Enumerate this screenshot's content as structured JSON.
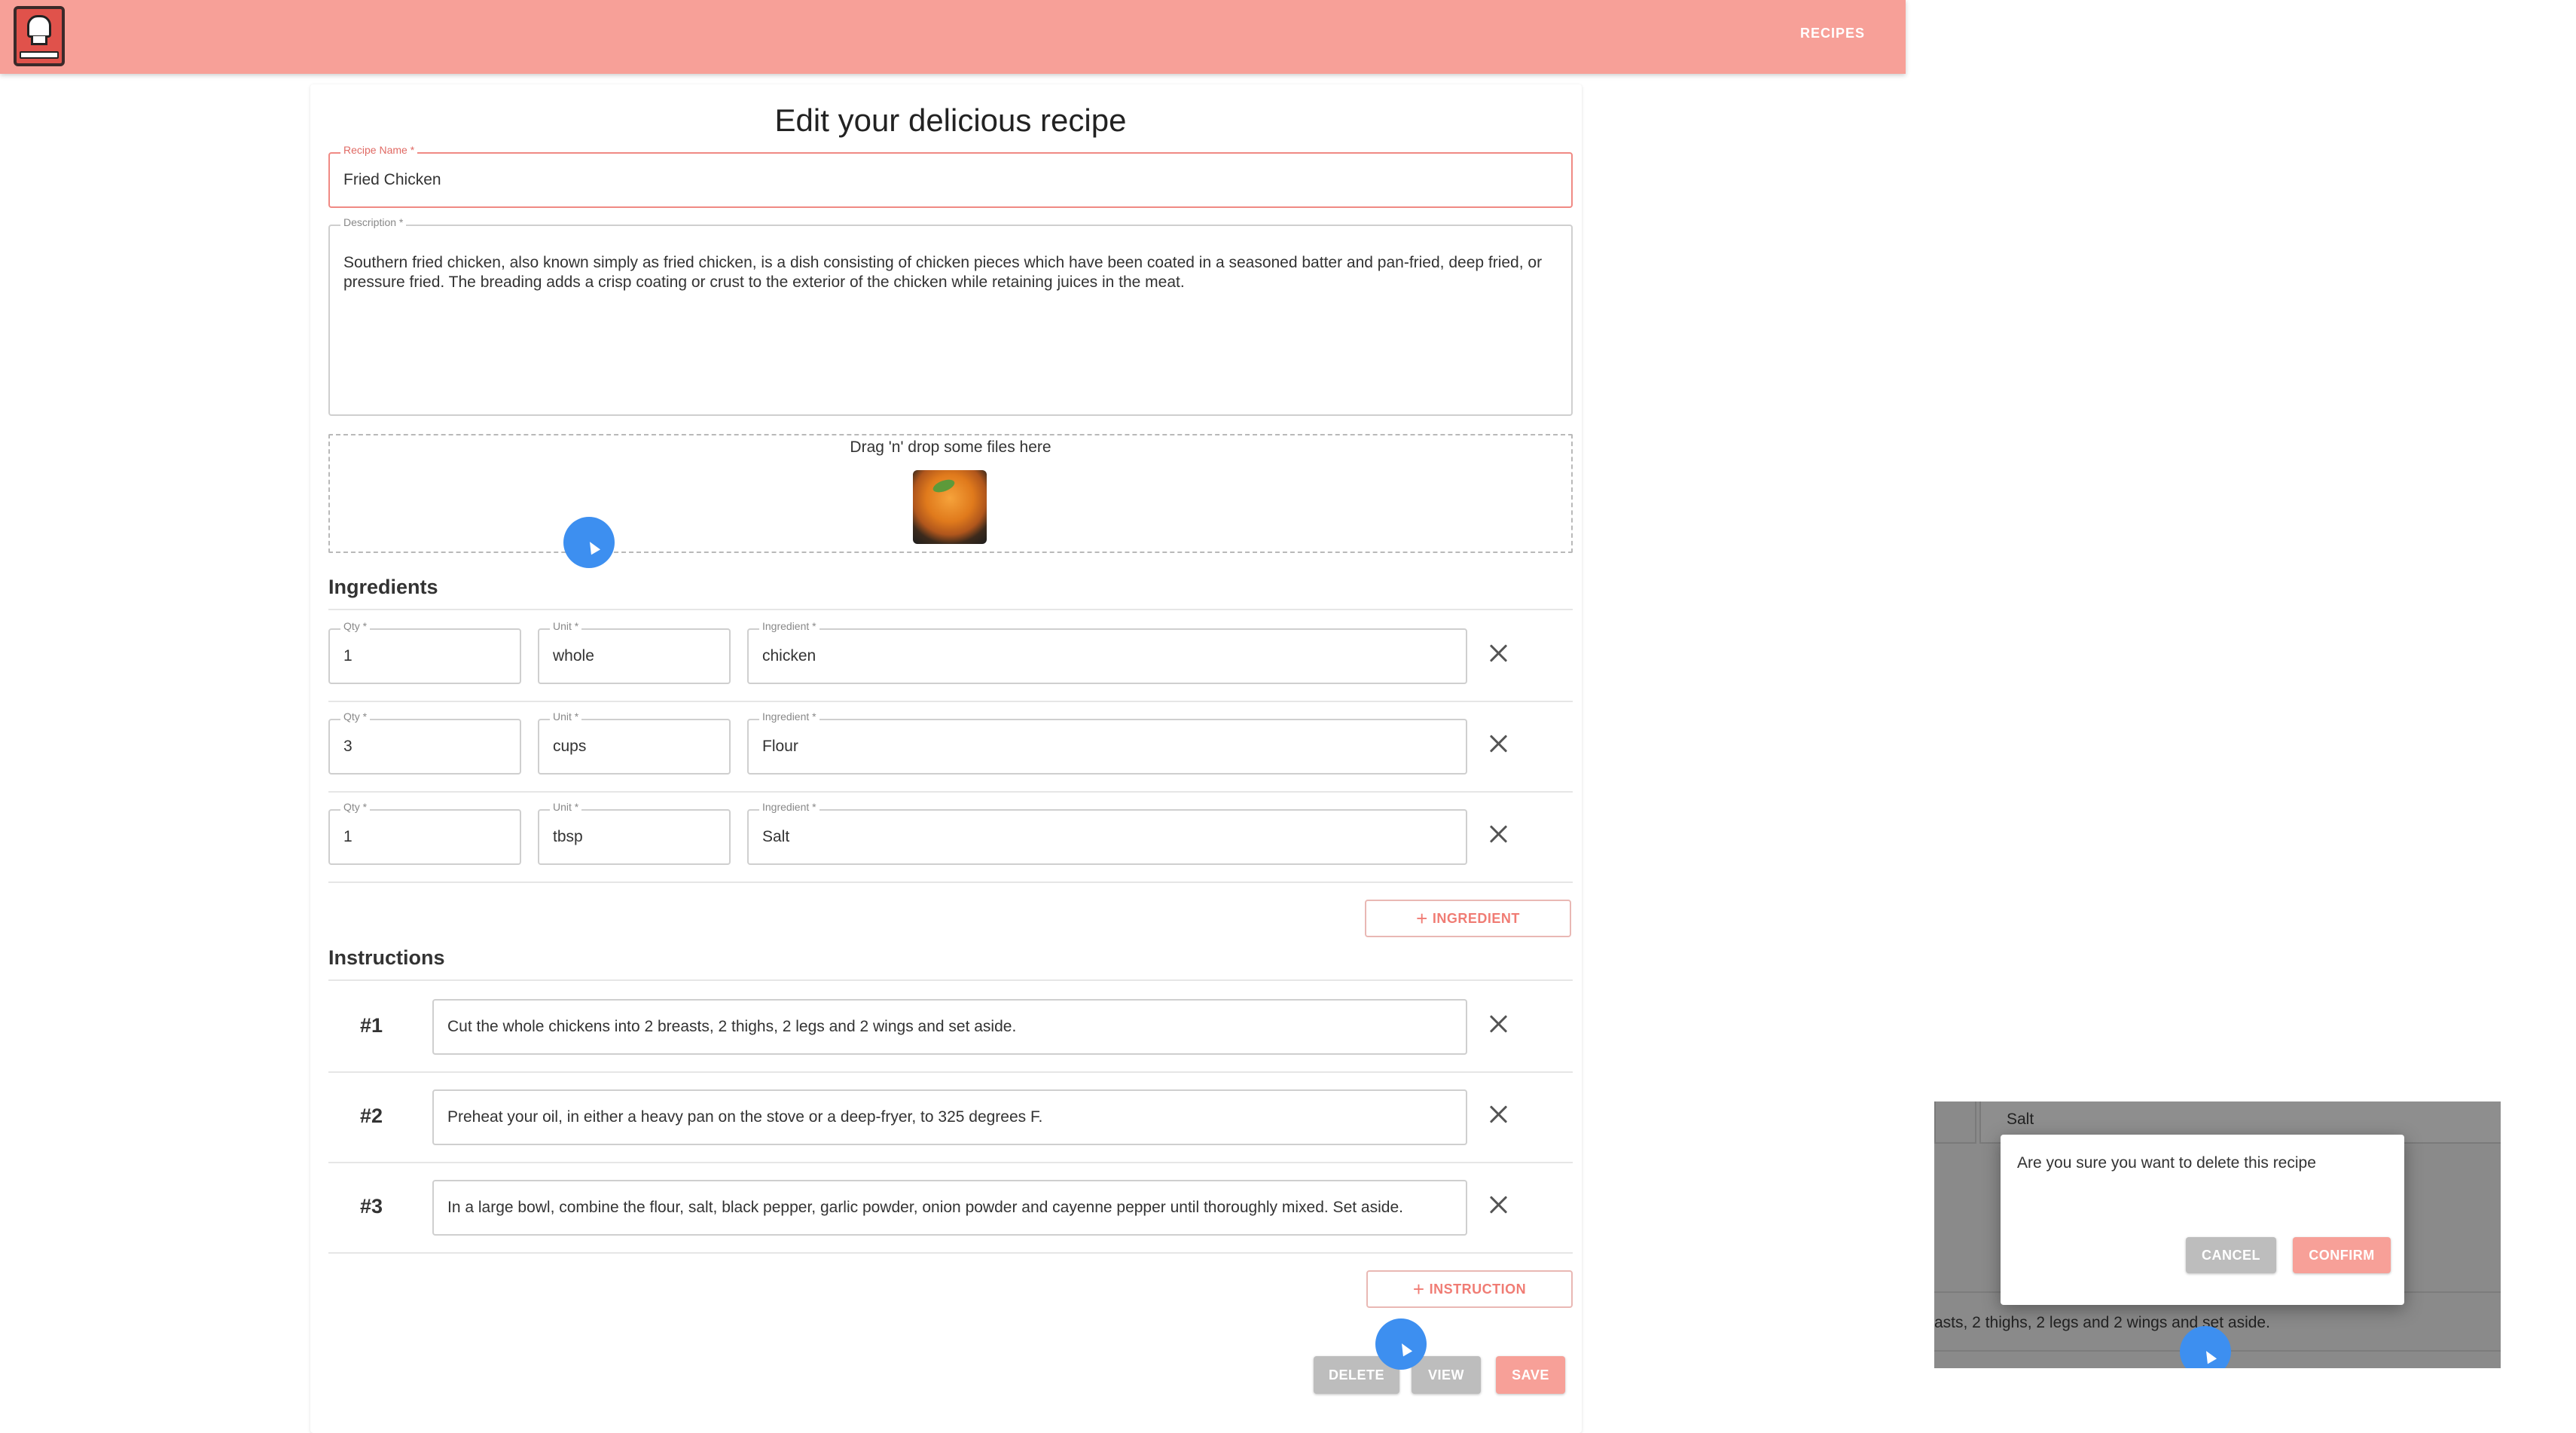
{
  "header": {
    "nav_recipes": "RECIPES"
  },
  "page": {
    "title": "Edit your delicious recipe"
  },
  "recipe_name": {
    "label": "Recipe Name *",
    "value": "Fried Chicken"
  },
  "description": {
    "label": "Description *",
    "value": "Southern fried chicken, also known simply as fried chicken, is a dish consisting of chicken pieces which have been coated in a seasoned batter and pan-fried, deep fried, or pressure fried. The breading adds a crisp coating or crust to the exterior of the chicken while retaining juices in the meat."
  },
  "dropzone": {
    "text": "Drag 'n' drop some files here"
  },
  "ingredients": {
    "title": "Ingredients",
    "qty_label": "Qty *",
    "unit_label": "Unit *",
    "ingredient_label": "Ingredient *",
    "rows": [
      {
        "qty": "1",
        "unit": "whole",
        "ingredient": "chicken"
      },
      {
        "qty": "3",
        "unit": "cups",
        "ingredient": "Flour"
      },
      {
        "qty": "1",
        "unit": "tbsp",
        "ingredient": "Salt"
      }
    ],
    "add_label": "INGREDIENT"
  },
  "instructions": {
    "title": "Instructions",
    "steps": [
      {
        "num": "#1",
        "text": "Cut the whole chickens into 2 breasts, 2 thighs, 2 legs and 2 wings and set aside."
      },
      {
        "num": "#2",
        "text": "Preheat your oil, in either a heavy pan on the stove or a deep-fryer, to 325 degrees F."
      },
      {
        "num": "#3",
        "text": "In a large bowl, combine the flour, salt, black pepper, garlic powder, onion powder and cayenne pepper until thoroughly mixed. Set aside."
      }
    ],
    "add_label": "INSTRUCTION"
  },
  "actions": {
    "delete": "DELETE",
    "view": "VIEW",
    "save": "SAVE"
  },
  "overlay": {
    "bg_field_value": "Salt",
    "bg_row_text": "asts, 2 thighs, 2 legs and 2 wings and set aside.",
    "dialog": {
      "message": "Are you sure you want to delete this recipe",
      "cancel": "CANCEL",
      "confirm": "CONFIRM"
    }
  },
  "colors": {
    "appbar": "#f7a098",
    "accent": "#f07c74",
    "cursor": "#3d8ff0"
  }
}
